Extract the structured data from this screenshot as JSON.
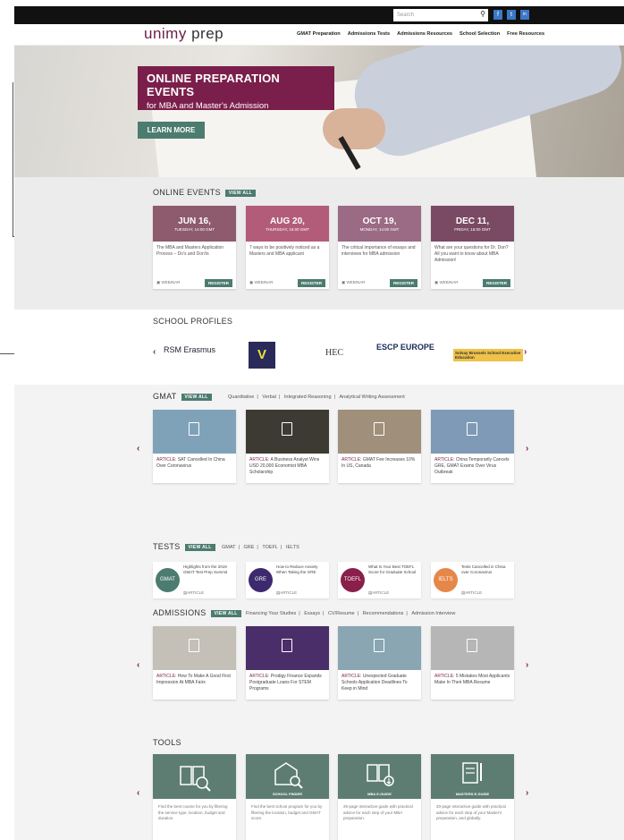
{
  "topbar": {
    "search_placeholder": "Search",
    "social": [
      "f",
      "t",
      "in"
    ]
  },
  "brand": {
    "logo_part1": "unimy",
    "logo_part2": " prep"
  },
  "nav": {
    "items": [
      "GMAT Preparation",
      "Admissions Tests",
      "Admissions Resources",
      "School Selection",
      "Free Resources"
    ]
  },
  "hero": {
    "title": "ONLINE PREPARATION EVENTS",
    "subtitle": "for MBA and Master's Admission",
    "cta": "LEARN MORE"
  },
  "events": {
    "title": "ONLINE EVENTS",
    "view_all": "VIEW ALL",
    "cards": [
      {
        "date": "JUN 16,",
        "day": "TUESDAY, 14:00 GMT",
        "text": "The MBA and Masters Application Process – Do's and Don'ts",
        "type": "WEBINAR",
        "button": "REGISTER",
        "color": "#8e5a6e"
      },
      {
        "date": "AUG 20,",
        "day": "THURSDAY, 16:00 GMT",
        "text": "7 ways to be positively noticed as a Masters and MBA applicant",
        "type": "WEBINAR",
        "button": "REGISTER",
        "color": "#b25c7a"
      },
      {
        "date": "OCT 19,",
        "day": "MONDAY, 14:00 GMT",
        "text": "The critical importance of essays and interviews for MBA admission",
        "type": "WEBINAR",
        "button": "REGISTER",
        "color": "#9b6a84"
      },
      {
        "date": "DEC 11,",
        "day": "FRIDAY, 16:00 GMT",
        "text": "What are your questions for Dr. Don? All you want to know about MBA Admission!",
        "type": "WEBINAR",
        "button": "REGISTER",
        "color": "#7a4a64"
      }
    ]
  },
  "schools": {
    "title": "SCHOOL PROFILES",
    "logos": [
      "RSM Erasmus",
      "V",
      "HEC",
      "ESCP EUROPE",
      "Solvay Brussels School Executive Education"
    ]
  },
  "gmat": {
    "title": "GMAT",
    "view_all": "VIEW ALL",
    "subnav": [
      "Quantitative",
      "Verbal",
      "Integrated Reasoning",
      "Analytical Writing Assessment"
    ],
    "cards": [
      {
        "prefix": "ARTICLE:",
        "text": "SAT Cancelled In China Over Coronavirus",
        "color": "#7fa2b8"
      },
      {
        "prefix": "ARTICLE:",
        "text": "A Business Analyst Wins USD 20,000 Economist MBA Scholarship",
        "color": "#3d3a33"
      },
      {
        "prefix": "ARTICLE:",
        "text": "GMAT Fee Increases 10% In US, Canada",
        "color": "#a08f7a"
      },
      {
        "prefix": "ARTICLE:",
        "text": "China Temporarily Cancels GRE, GMAT Exams Over Virus Outbreak",
        "color": "#7e9ab6"
      }
    ]
  },
  "tests": {
    "title": "TESTS",
    "view_all": "VIEW ALL",
    "subnav": [
      "GMAT",
      "GRE",
      "TOEFL",
      "IELTS"
    ],
    "cards": [
      {
        "badge": "GMAT",
        "text": "Highlights from the 2019 GMAT Test Prep Summit",
        "type": "ARTICLE",
        "color": "#4c7b6f"
      },
      {
        "badge": "GRE",
        "text": "How to Reduce Anxiety When Taking the GRE",
        "type": "ARTICLE",
        "color": "#3d2a6e"
      },
      {
        "badge": "TOEFL",
        "text": "What Is Your Best TOEFL Score for Graduate School",
        "type": "ARTICLE",
        "color": "#8a1f4b"
      },
      {
        "badge": "IELTS",
        "text": "Tests Cancelled in China over Coronavirus",
        "type": "ARTICLE",
        "color": "#e6874a"
      }
    ]
  },
  "admissions": {
    "title": "ADMISSIONS",
    "view_all": "VIEW ALL",
    "subnav": [
      "Financing Your Studies",
      "Essays",
      "CV/Resume",
      "Recommendations",
      "Admission Interview"
    ],
    "cards": [
      {
        "prefix": "ARTICLE:",
        "text": "How To Make A Good First Impression At MBA Fairs",
        "color": "#c4c0b8"
      },
      {
        "prefix": "ARTICLE:",
        "text": "Prodigy Finance Expands Postgraduate Loans For STEM Programs",
        "color": "#4a2e6a"
      },
      {
        "prefix": "ARTICLE:",
        "text": "Unexpected Graduate Schools Application Deadlines To Keep in Mind",
        "color": "#8aa6b2"
      },
      {
        "prefix": "ARTICLE:",
        "text": "5 Mistakes Most Applicants Make In Their MBA Resume",
        "color": "#b6b6b6"
      }
    ]
  },
  "tools": {
    "title": "TOOLS",
    "cards": [
      {
        "label": "",
        "text": "Find the best course for you by filtering the service type, location, budget and duration."
      },
      {
        "label": "SCHOOL FINDER",
        "text": "Find the best school program for you by filtering the location, budget and GMAT score."
      },
      {
        "label": "MBA E-GUIDE",
        "text": "25-page interactive guide with practical advice for each step of your MBA preparation."
      },
      {
        "label": "MASTERS E-GUIDE",
        "text": "20-page interactive guide with practical advice for each step of your Master's preparation, and globally."
      }
    ]
  },
  "theme": {
    "accent": "#7a1f4b",
    "green": "#4c7b6f"
  }
}
